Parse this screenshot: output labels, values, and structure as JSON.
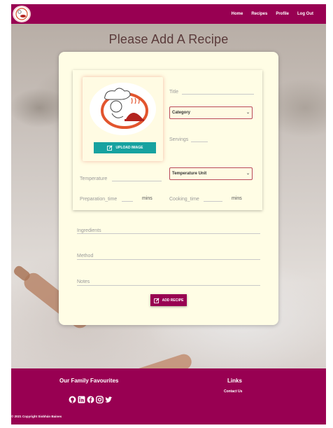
{
  "nav": {
    "links": [
      "Home",
      "Recipes",
      "Profile",
      "Log Out"
    ]
  },
  "page_title": "Please Add A Recipe",
  "form": {
    "upload_label": "UPLOAD IMAGE",
    "title_label": "Title",
    "category_selected": "Category",
    "servings_label": "Servings",
    "temperature_label": "Temperature",
    "temperature_unit_selected": "Temperature Unit",
    "preparation_label": "Preparation_time",
    "cooking_label": "Cooking_time",
    "mins_unit": "mins",
    "ingredients_label": "Ingredients",
    "method_label": "Method",
    "notes_label": "Notes",
    "add_button_label": "ADD RECIPE"
  },
  "footer": {
    "brand_title": "Our Family Favourites",
    "links_title": "Links",
    "contact_link": "Contact Us",
    "social_icons": [
      "github-icon",
      "linkedin-icon",
      "facebook-icon",
      "instagram-icon",
      "twitter-icon"
    ],
    "copyright": "© 2021 Copyright Siobhán Baines"
  },
  "colors": {
    "brand": "#980052",
    "card": "#fffde5",
    "upload_button": "#17a2a0"
  }
}
